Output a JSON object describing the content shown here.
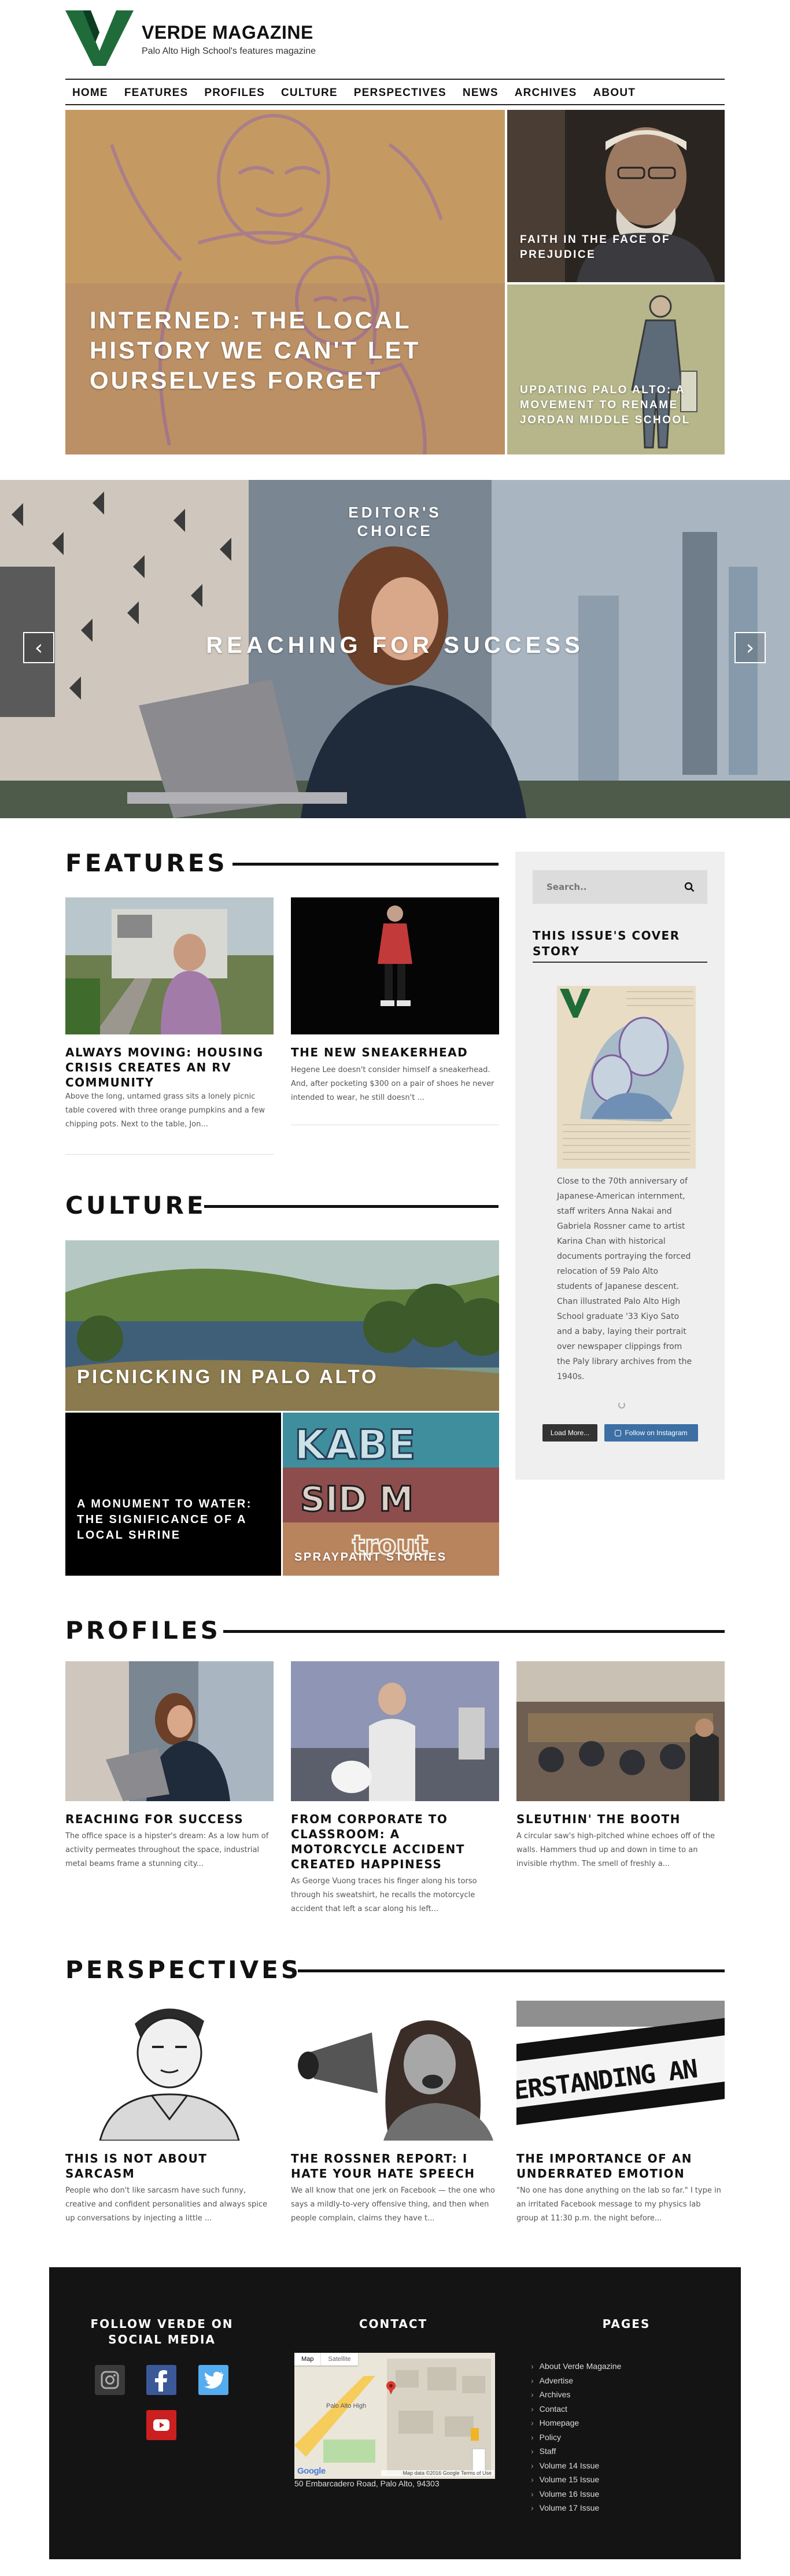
{
  "brand": {
    "title": "VERDE MAGAZINE",
    "tagline": "Palo Alto High School's features magazine",
    "color": "#1f6b3a"
  },
  "nav": {
    "items": [
      "HOME",
      "FEATURES",
      "PROFILES",
      "CULTURE",
      "PERSPECTIVES",
      "NEWS",
      "ARCHIVES",
      "ABOUT"
    ]
  },
  "featured": {
    "main_title": "INTERNED: THE LOCAL HISTORY WE CAN'T LET OURSELVES FORGET",
    "side_top_title": "FAITH IN THE FACE OF PREJUDICE",
    "side_bottom_title": "UPDATING PALO ALTO: A MOVEMENT TO RENAME JORDAN MIDDLE SCHOOL"
  },
  "carousel": {
    "label": "EDITOR'S CHOICE",
    "title": "REACHING FOR SUCCESS",
    "prev_icon": "chevron-left-icon",
    "next_icon": "chevron-right-icon"
  },
  "features": {
    "heading": "FEATURES",
    "items": [
      {
        "title": "ALWAYS MOVING: HOUSING CRISIS CREATES AN RV COMMUNITY",
        "excerpt": "Above the long, untamed grass sits a lonely picnic table covered with three orange pumpkins and a few chipping pots.  Next to the table, Jon..."
      },
      {
        "title": "THE NEW SNEAKERHEAD",
        "excerpt": "Hegene Lee doesn't consider himself a sneakerhead. And, after pocketing $300 on a pair of shoes he never intended to wear, he still doesn't ..."
      }
    ]
  },
  "culture": {
    "heading": "CULTURE",
    "main_title": "PICNICKING IN PALO ALTO",
    "left_title": "A MONUMENT TO WATER: THE SIGNIFICANCE OF A LOCAL SHRINE",
    "right_title": "SPRAYPAINT STORIES"
  },
  "sidebar": {
    "search_placeholder": "Search..",
    "search_icon": "search-icon",
    "cover_heading": "THIS ISSUE'S COVER STORY",
    "cover_text": "Close to the 70th anniversary of Japanese-American internment, staff writers Anna Nakai and Gabriela Rossner came to artist Karina Chan with historical documents portraying the forced relocation of 59 Palo Alto students of Japanese descent. Chan illustrated Palo Alto High School graduate '33 Kiyo Sato and a baby, laying their portrait over newspaper clippings from the Paly library archives from the 1940s.",
    "load_more": "Load More...",
    "follow_instagram": "Follow on Instagram"
  },
  "profiles": {
    "heading": "PROFILES",
    "items": [
      {
        "title": "REACHING FOR SUCCESS",
        "excerpt": "The office space is a hipster's dream: As a low hum of activity permeates throughout the space, industrial metal beams frame a stunning city..."
      },
      {
        "title": "FROM CORPORATE TO CLASSROOM: A MOTORCYCLE ACCIDENT CREATED HAPPINESS",
        "excerpt": "As George Vuong traces his finger along his torso through his sweatshirt, he recalls the motorcycle accident that left a scar along his left..."
      },
      {
        "title": "SLEUTHIN' THE BOOTH",
        "excerpt": "A circular saw's high-pitched whine echoes off of the walls. Hammers thud up and down in time to an invisible rhythm. The smell of freshly a..."
      }
    ]
  },
  "perspectives": {
    "heading": "PERSPECTIVES",
    "items": [
      {
        "title": "THIS IS NOT ABOUT SARCASM",
        "excerpt": "People who don't like sarcasm have such funny, creative and confident personalities and always spice up conversations by injecting a little ..."
      },
      {
        "title": "THE ROSSNER REPORT: I HATE YOUR HATE SPEECH",
        "excerpt": "We all know that one jerk on Facebook — the one who says a mildly-to-very offensive thing, and then when people complain, claims they have t..."
      },
      {
        "title": "THE IMPORTANCE OF AN UNDERRATED EMOTION",
        "excerpt": "\"No one has done anything on the lab so far.\" I type in an irritated Facebook message to my physics lab group at 11:30 p.m. the night before..."
      }
    ],
    "banner_text": "ERSTANDING AN"
  },
  "footer": {
    "social_heading": "FOLLOW VERDE ON SOCIAL MEDIA",
    "contact_heading": "CONTACT",
    "pages_heading": "PAGES",
    "address": "50 Embarcadero Road, Palo Alto, 94303",
    "map_tabs": [
      "Map",
      "Satellite"
    ],
    "map_place": "Palo Alto High",
    "map_footer": "Map data ©2016 Google   Terms of Use",
    "pages": [
      "About Verde Magazine",
      "Advertise",
      "Archives",
      "Contact",
      "Homepage",
      "Policy",
      "Staff",
      "Volume 14 Issue",
      "Volume 15 Issue",
      "Volume 16 Issue",
      "Volume 17 Issue"
    ],
    "social_icons": [
      "instagram-icon",
      "facebook-icon",
      "twitter-icon",
      "youtube-icon"
    ],
    "colors": {
      "facebook": "#3b5998",
      "twitter": "#55acee",
      "youtube": "#cc1f1f",
      "instagram": "#3a3a3a"
    }
  }
}
